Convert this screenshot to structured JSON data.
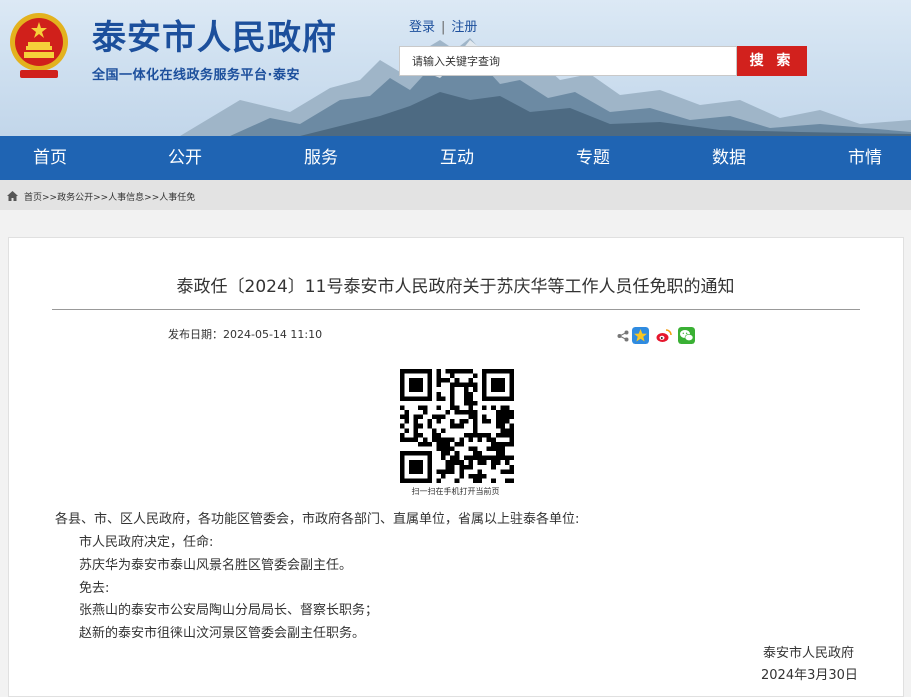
{
  "header": {
    "title": "泰安市人民政府",
    "subtitle": "全国一体化在线政务服务平台·泰安",
    "login": "登录",
    "separator": "|",
    "register": "注册",
    "search_placeholder": "请输入关键字查询",
    "search_button": "搜 索"
  },
  "nav": {
    "items": [
      "首页",
      "公开",
      "服务",
      "互动",
      "专题",
      "数据",
      "市情"
    ]
  },
  "breadcrumb": {
    "text": "首页>>政务公开>>人事信息>>人事任免"
  },
  "article": {
    "title": "泰政任〔2024〕11号泰安市人民政府关于苏庆华等工作人员任免职的通知",
    "date_label": "发布日期：",
    "date_value": "2024-05-14 11:10",
    "qr_caption": "扫一扫在手机打开当前页",
    "body": [
      "各县、市、区人民政府，各功能区管委会，市政府各部门、直属单位，省属以上驻泰各单位:",
      "市人民政府决定，任命:",
      "苏庆华为泰安市泰山风景名胜区管委会副主任。",
      "免去:",
      "张燕山的泰安市公安局陶山分局局长、督察长职务；",
      "赵新的泰安市徂徕山汶河景区管委会副主任职务。"
    ],
    "signature": "泰安市人民政府",
    "sign_date": "2024年3月30日"
  },
  "colors": {
    "brand_blue": "#1c4f9c",
    "nav_blue": "#1f64b3",
    "search_red": "#d2211d"
  },
  "icons": [
    "national-emblem-icon",
    "home-icon",
    "share-icon",
    "qzone-icon",
    "weibo-icon",
    "wechat-icon"
  ]
}
